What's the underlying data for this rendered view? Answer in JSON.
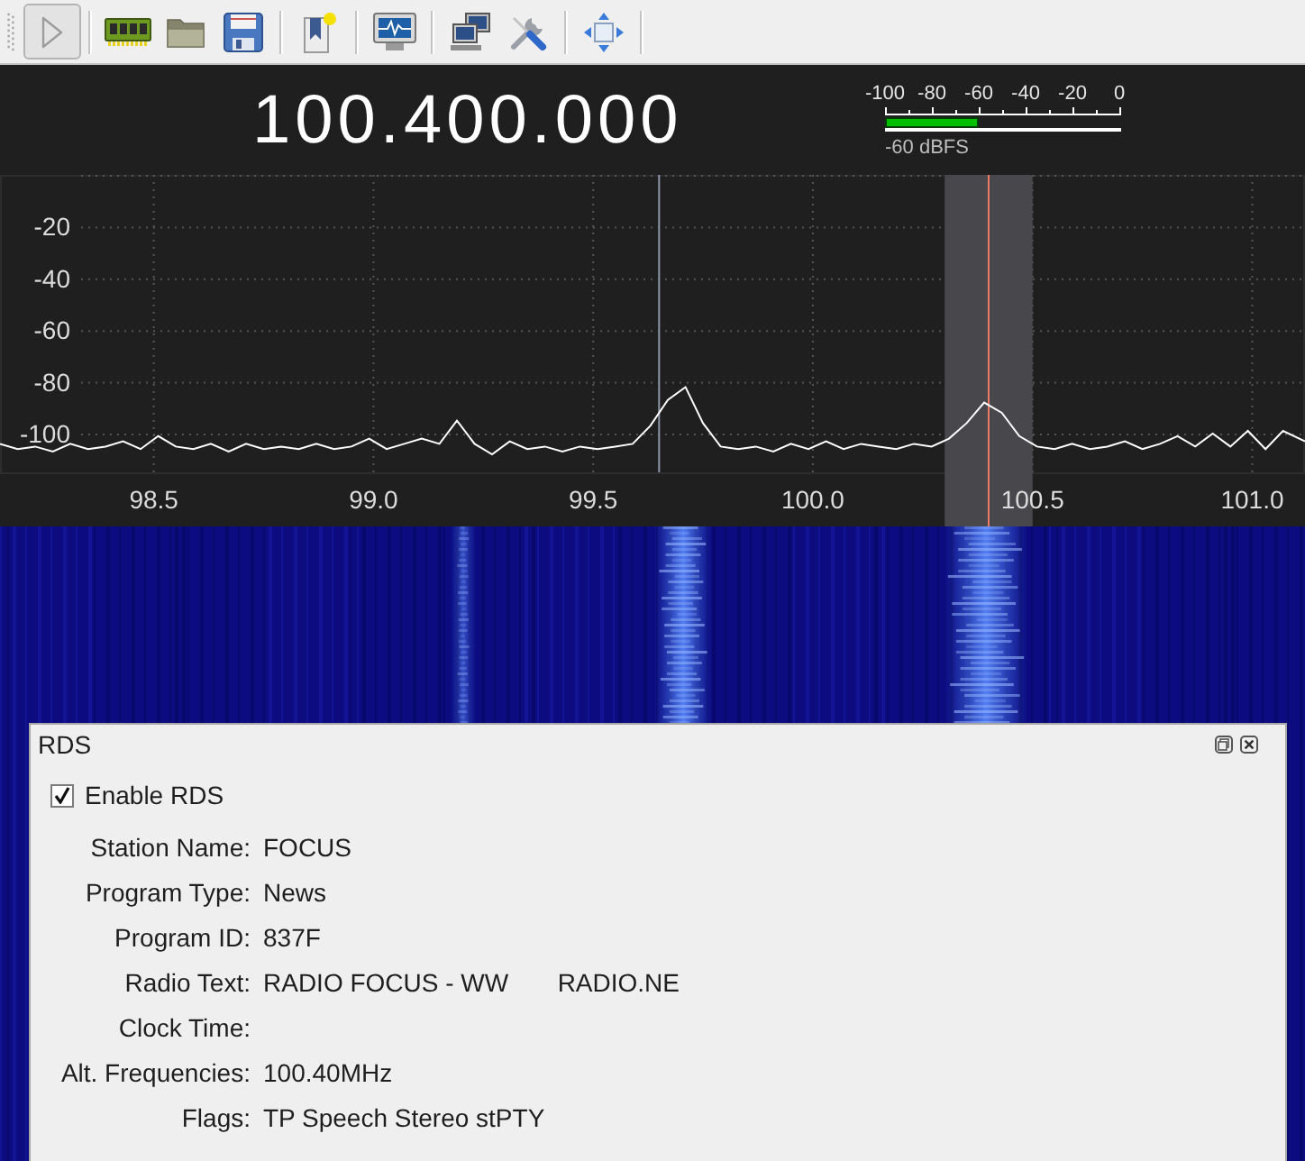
{
  "toolbar": {
    "groups": [
      [
        {
          "kind": "start",
          "active": true
        }
      ],
      [
        {
          "kind": "device",
          "active": false
        },
        {
          "kind": "open",
          "active": false
        },
        {
          "kind": "save",
          "active": false
        }
      ],
      [
        {
          "kind": "bookmark",
          "active": false
        }
      ],
      [
        {
          "kind": "dsp",
          "active": false
        }
      ],
      [
        {
          "kind": "remote",
          "active": false
        },
        {
          "kind": "settings",
          "active": false
        }
      ],
      [
        {
          "kind": "fullscreen",
          "active": false
        }
      ]
    ]
  },
  "frequency": "100.400.000",
  "signal_meter": {
    "scale": [
      "-100",
      "-80",
      "-60",
      "-40",
      "-20",
      "0"
    ],
    "level": 0.4,
    "reading": "-60 dBFS"
  },
  "spectrum": {
    "chart_data": {
      "type": "line",
      "x": [
        98.15,
        98.19,
        98.23,
        98.27,
        98.31,
        98.35,
        98.39,
        98.43,
        98.47,
        98.51,
        98.55,
        98.59,
        98.63,
        98.67,
        98.71,
        98.75,
        98.79,
        98.83,
        98.87,
        98.91,
        98.95,
        98.99,
        99.03,
        99.07,
        99.11,
        99.15,
        99.19,
        99.23,
        99.27,
        99.31,
        99.35,
        99.39,
        99.43,
        99.47,
        99.51,
        99.55,
        99.59,
        99.63,
        99.67,
        99.71,
        99.75,
        99.79,
        99.83,
        99.87,
        99.91,
        99.95,
        99.99,
        100.03,
        100.07,
        100.11,
        100.15,
        100.19,
        100.23,
        100.27,
        100.31,
        100.35,
        100.39,
        100.43,
        100.47,
        100.51,
        100.55,
        100.59,
        100.63,
        100.67,
        100.71,
        100.75,
        100.79,
        100.83,
        100.87,
        100.91,
        100.95,
        100.99,
        101.03,
        101.07,
        101.12
      ],
      "series": [
        {
          "color": "#ffffff",
          "values": [
            -104,
            -106,
            -105,
            -107,
            -104,
            -106,
            -105,
            -103,
            -106,
            -101,
            -105,
            -106,
            -104,
            -107,
            -104,
            -106,
            -105,
            -106,
            -104,
            -106,
            -105,
            -102,
            -106,
            -104,
            -102,
            -104,
            -95,
            -104,
            -108,
            -103,
            -106,
            -105,
            -107,
            -105,
            -106,
            -105,
            -104,
            -97,
            -87,
            -82,
            -96,
            -105,
            -106,
            -105,
            -107,
            -104,
            -106,
            -103,
            -106,
            -104,
            -105,
            -106,
            -104,
            -105,
            -102,
            -96,
            -88,
            -92,
            -101,
            -105,
            -106,
            -104,
            -106,
            -105,
            -103,
            -106,
            -104,
            -101,
            -105,
            -100,
            -105,
            -99,
            -106,
            -99,
            -103
          ]
        }
      ],
      "xlim": [
        98.15,
        101.12
      ],
      "ylim": [
        -115,
        0
      ],
      "xticks": [
        {
          "value": 98.5,
          "label": "98.5"
        },
        {
          "value": 99,
          "label": "99.0"
        },
        {
          "value": 99.5,
          "label": "99.5"
        },
        {
          "value": 100,
          "label": "100.0"
        },
        {
          "value": 100.5,
          "label": "100.5"
        },
        {
          "value": 101,
          "label": "101.0"
        }
      ],
      "yticks": [
        -20,
        -40,
        -60,
        -80,
        -100
      ],
      "grid": true,
      "ref_lines": [
        {
          "axis": "x",
          "value": 99.65,
          "color": "#8c96aa"
        },
        {
          "axis": "x",
          "value": 100.4,
          "color": "#f07a66"
        }
      ],
      "bands": [
        {
          "axis": "x",
          "from": 100.3,
          "to": 100.5,
          "color": "#48474b"
        }
      ]
    }
  },
  "rds_panel": {
    "title": "RDS",
    "enable": {
      "label": "Enable RDS",
      "checked": true
    },
    "fields": [
      {
        "label": "Station Name:",
        "value": "FOCUS"
      },
      {
        "label": "Program Type:",
        "value": "News"
      },
      {
        "label": "Program ID:",
        "value": "837F"
      },
      {
        "label": "Radio Text:",
        "value": "RADIO FOCUS - WW       RADIO.NE"
      },
      {
        "label": "Clock Time:"
      },
      {
        "label": "Alt. Frequencies:",
        "value": "100.40MHz"
      },
      {
        "label": "Flags:",
        "value": "TP Speech Stereo stPTY"
      }
    ]
  }
}
